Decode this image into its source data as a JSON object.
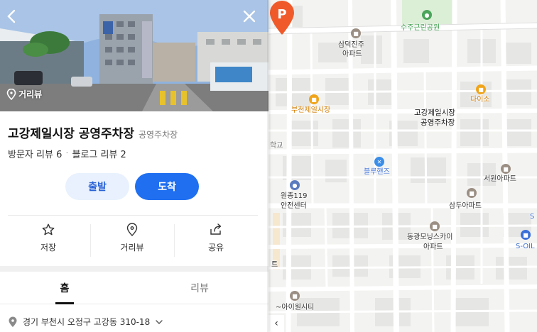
{
  "map": {
    "labels": {
      "park": "수주근린공원",
      "apt1_line1": "삼덕진주",
      "apt1_line2": "아파트",
      "market": "부천제일시장",
      "daiso": "다이소",
      "pin_line1": "고강제일시장",
      "pin_line2": "공영주차장",
      "school": "학교",
      "bluehands": "블루핸즈",
      "seowon_apt": "서원아파트",
      "fire_line1": "원종119",
      "fire_line2": "안전센터",
      "samdu_apt": "삼두아파트",
      "donggwang_line1": "동광모닝스카이",
      "donggwang_line2": "아파트",
      "soil": "S-OIL",
      "s_edge": "S",
      "ite": "트",
      "icity": "~아이원시티"
    },
    "pin_letter": "P",
    "colors": {
      "pin": "#f05a2a",
      "park": "#dbeed6",
      "road": "#ffffff"
    },
    "collapse_icon": "chevron-left-icon"
  },
  "panel": {
    "photo": {
      "back_icon": "chevron-left-icon",
      "close_icon": "close-icon",
      "roadview_label": "거리뷰"
    },
    "place_name": "고강제일시장 공영주차장",
    "category": "공영주차장",
    "visitor_review": "방문자 리뷰 6",
    "blog_review": "블로그 리뷰 2",
    "buttons": {
      "depart": "출발",
      "arrive": "도착"
    },
    "actions": [
      {
        "label": "저장",
        "icon": "star-icon"
      },
      {
        "label": "거리뷰",
        "icon": "location-pin-icon"
      },
      {
        "label": "공유",
        "icon": "share-icon"
      }
    ],
    "tabs": [
      {
        "label": "홈",
        "active": true
      },
      {
        "label": "리뷰",
        "active": false
      }
    ],
    "address": "경기 부천시 오정구 고강동 310-18",
    "colors": {
      "accent": "#1f6ff0",
      "accent_light": "#e8f1fd"
    }
  }
}
